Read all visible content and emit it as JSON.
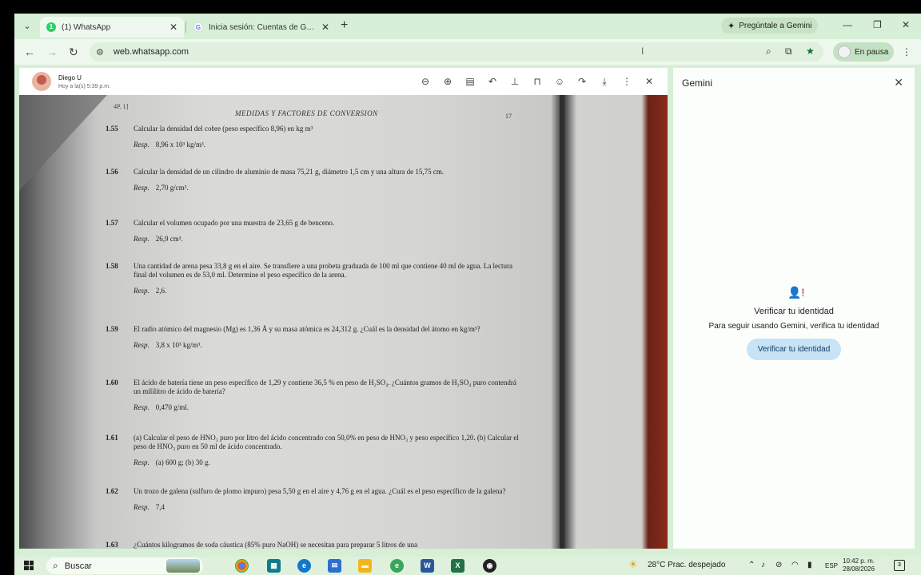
{
  "browser": {
    "tabs": [
      {
        "title": "(1) WhatsApp",
        "active": true,
        "icon": "whatsapp-icon",
        "badge": "1"
      },
      {
        "title": "Inicia sesión: Cuentas de Google",
        "active": false,
        "icon": "google-icon"
      }
    ],
    "gemini_button": "Pregúntale a Gemini",
    "url": "web.whatsapp.com",
    "profile_label": "En pausa"
  },
  "viewer": {
    "contact_name": "Diego U",
    "timestamp": "Hoy a la(s) 5:39 p.m."
  },
  "document": {
    "page_tag": "4P. 1]",
    "header": "MEDIDAS Y FACTORES DE CONVERSION",
    "page_number": "17",
    "resp_label": "Resp.",
    "problems": [
      {
        "num": "1.55",
        "text": "Calcular la densidad del cobre (peso específico 8,96) en kg m³",
        "resp": "8,96 x 10³ kg/m³."
      },
      {
        "num": "1.56",
        "text": "Calcular la densidad de un cilindro de aluminio de masa 75,21 g, diámetro 1,5 cm y una altura de 15,75 cm.",
        "resp": "2,70 g/cm³."
      },
      {
        "num": "1.57",
        "text": "Calcular el volumen ocupado por una muestra de 23,65 g de benceno.",
        "resp": "26,9 cm³."
      },
      {
        "num": "1.58",
        "text": "Una cantidad de arena pesa 33,8 g en el aire. Se transfiere a una probeta graduada de 100 ml que contiene 40 ml de agua. La lectura final del volumen es de 53,0 ml. Determine el peso específico de la arena.",
        "resp": "2,6."
      },
      {
        "num": "1.59",
        "text": "El radio atómico del magnesio (Mg) es 1,36 Å y su masa atómica es 24,312 g. ¿Cuál es la densidad del átomo en kg/m³?",
        "resp": "3,8 x 10³ kg/m³."
      },
      {
        "num": "1.60",
        "text": "El ácido de batería tiene un peso específico de 1,29 y contiene 36,5 % en peso de H₂SO₄. ¿Cuántos gramos de H₂SO₄ puro contendrá un mililitro de ácido de batería?",
        "resp": "0,470 g/ml."
      },
      {
        "num": "1.61",
        "text": "(a) Calcular el peso de HNO₃ puro por litro del ácido concentrado con 50,0% en peso de HNO₃ y peso específico 1,20. (b) Calcular el peso de HNO₃ puro en 50 ml de ácido concentrado.",
        "resp": "(a) 600 g; (b) 30 g."
      },
      {
        "num": "1.62",
        "text": "Un trozo de galena (sulfuro de plomo impuro) pesa 5,50 g en el aire y 4,76 g en el agua. ¿Cuál es el peso específico de la galena?",
        "resp": "7,4"
      },
      {
        "num": "1.63",
        "text": "¿Cuántos kilogramos de soda cáustica (85% puro NaOH) se necesitan para preparar 5 litros de una",
        "resp": ""
      }
    ]
  },
  "gemini": {
    "title": "Gemini",
    "verify_title": "Verificar tu identidad",
    "verify_subtitle": "Para seguir usando Gemini, verifica tu identidad",
    "verify_button": "Verificar tu identidad"
  },
  "taskbar": {
    "search_placeholder": "Buscar",
    "weather": "28°C  Prac. despejado",
    "language": "ESP",
    "time": "10:42 p. m.",
    "date": "28/08/2026",
    "notification_count": "3"
  },
  "colors": {
    "chrome_frame": "#d7efd6",
    "whatsapp_green": "#25d366",
    "accent_button": "#c8e3f5"
  }
}
